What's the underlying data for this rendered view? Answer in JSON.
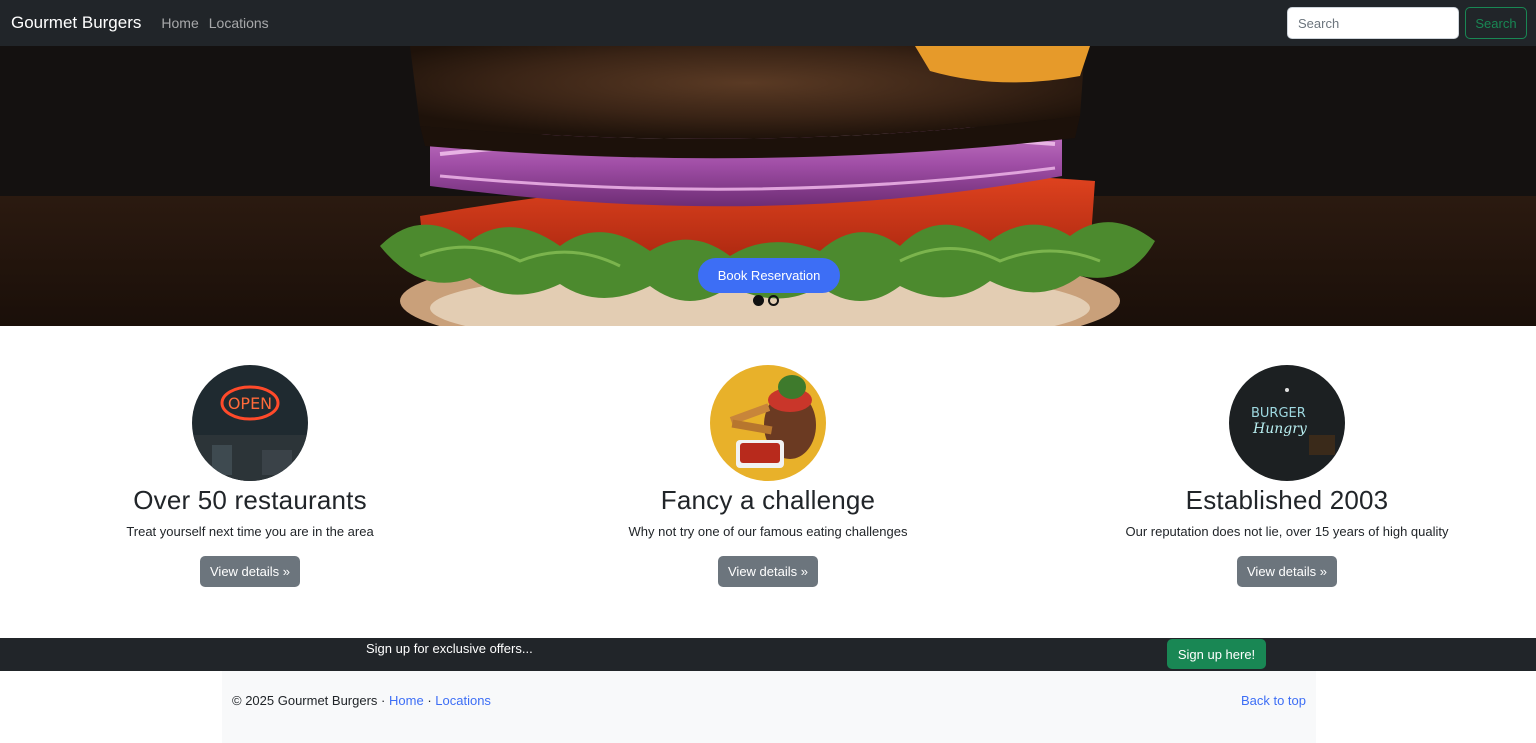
{
  "navbar": {
    "brand": "Gourmet Burgers",
    "links": [
      "Home",
      "Locations"
    ],
    "search_placeholder": "Search",
    "search_button": "Search"
  },
  "hero": {
    "cta_label": "Book Reservation",
    "slide_count": 2,
    "active_slide": 1
  },
  "features": [
    {
      "title": "Over 50 restaurants",
      "text": "Treat yourself next time you are in the area",
      "button": "View details »",
      "image": "open-neon-sign-photo"
    },
    {
      "title": "Fancy a challenge",
      "text": "Why not try one of our famous eating challenges",
      "button": "View details »",
      "image": "burger-and-fries-photo"
    },
    {
      "title": "Established 2003",
      "text": "Our reputation does not lie, over 15 years of high quality",
      "button": "View details »",
      "image": "neon-burger-sign-photo"
    }
  ],
  "signup": {
    "text": "Sign up for exclusive offers...",
    "button": "Sign up here!"
  },
  "footer": {
    "copyright": "© 2025 Gourmet Burgers ·",
    "sep": "·",
    "links": [
      "Home",
      "Locations"
    ],
    "back_to_top": "Back to top"
  },
  "colors": {
    "navbar_bg": "#212529",
    "primary": "#3d6ef5",
    "success": "#198754",
    "secondary": "#6c757d",
    "footer_bg": "#f8f9fa"
  }
}
